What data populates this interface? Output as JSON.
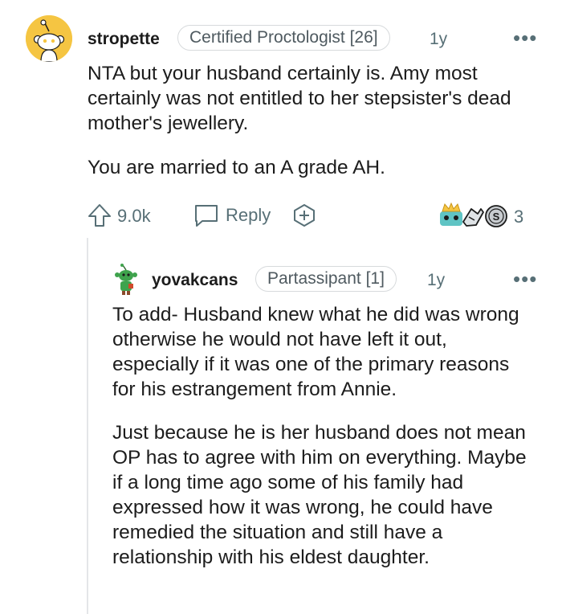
{
  "comment": {
    "username": "stropette",
    "flair": "Certified Proctologist [26]",
    "age": "1y",
    "more": "•••",
    "paragraphs": [
      "NTA but your husband certainly is. Amy most certainly was not entitled to her stepsister's dead mother's jewellery.",
      "You are married to an A grade AH."
    ],
    "vote_count": "9.0k",
    "reply_label": "Reply",
    "award_count": "3"
  },
  "reply": {
    "username": "yovakcans",
    "flair": "Partassipant [1]",
    "age": "1y",
    "more": "•••",
    "paragraphs": [
      "To add- Husband knew what he did was wrong otherwise he would not have left it out, especially if it was one of the primary reasons for his estrangement from Annie.",
      "Just because he is her husband does not mean OP has to agree with him on everything. Maybe if a long time ago some of his family had expressed how it was wrong, he could have remedied the situation and still have a relationship with his eldest daughter."
    ]
  },
  "icons": {
    "avatar": "snoo-avatar-icon",
    "upvote": "upvote-arrow-icon",
    "reply": "speech-bubble-icon",
    "award": "add-award-icon",
    "awards": [
      "crown-award-icon",
      "hand-award-icon",
      "silver-award-icon"
    ]
  },
  "colors": {
    "avatar_bg": "#f5c542",
    "text": "#1c1c1c",
    "muted": "#576f76",
    "flair_border": "#d7dadc",
    "thread_line": "#e4e6e8"
  }
}
